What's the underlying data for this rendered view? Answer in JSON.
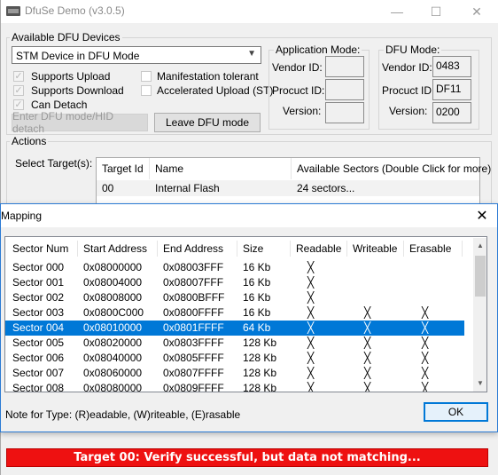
{
  "main": {
    "title": "DfuSe Demo (v3.0.5)",
    "titlebar_buttons": {
      "minimize": "—",
      "maximize": "☐",
      "close": "✕"
    },
    "devices_group": {
      "label": "Available DFU Devices",
      "selected_device": "STM Device in DFU Mode",
      "checkboxes": [
        {
          "label": "Supports Upload",
          "checked": true
        },
        {
          "label": "Supports Download",
          "checked": true
        },
        {
          "label": "Can Detach",
          "checked": true
        },
        {
          "label": "Manifestation tolerant",
          "checked": false
        },
        {
          "label": "Accelerated Upload (ST)",
          "checked": false
        }
      ],
      "enter_dfu_button": "Enter DFU mode/HID detach",
      "leave_dfu_button": "Leave DFU mode"
    },
    "app_mode": {
      "label": "Application Mode:",
      "vendor_label": "Vendor ID:",
      "product_label": "Procuct ID:",
      "version_label": "Version:",
      "vendor_value": "",
      "product_value": "",
      "version_value": ""
    },
    "dfu_mode": {
      "label": "DFU Mode:",
      "vendor_label": "Vendor ID:",
      "product_label": "Procuct ID:",
      "version_label": "Version:",
      "vendor_value": "0483",
      "product_value": "DF11",
      "version_value": "0200"
    },
    "actions": {
      "label": "Actions",
      "select_target_label": "Select Target(s):",
      "columns": [
        "Target Id",
        "Name",
        "Available Sectors (Double Click for more)"
      ],
      "rows": [
        {
          "id": "00",
          "name": "Internal Flash",
          "sectors": "24 sectors..."
        }
      ]
    },
    "status_message": "Target 00: Verify successful, but data not matching..."
  },
  "mapping": {
    "title": "Mapping",
    "close_glyph": "✕",
    "columns": [
      "Sector Num",
      "Start Address",
      "End Address",
      "Size",
      "Readable",
      "Writeable",
      "Erasable"
    ],
    "rows": [
      {
        "num": "Sector 000",
        "start": "0x08000000",
        "end": "0x08003FFF",
        "size": "16 Kb",
        "r": "╳",
        "w": "",
        "e": ""
      },
      {
        "num": "Sector 001",
        "start": "0x08004000",
        "end": "0x08007FFF",
        "size": "16 Kb",
        "r": "╳",
        "w": "",
        "e": ""
      },
      {
        "num": "Sector 002",
        "start": "0x08008000",
        "end": "0x0800BFFF",
        "size": "16 Kb",
        "r": "╳",
        "w": "",
        "e": ""
      },
      {
        "num": "Sector 003",
        "start": "0x0800C000",
        "end": "0x0800FFFF",
        "size": "16 Kb",
        "r": "╳",
        "w": "╳",
        "e": "╳"
      },
      {
        "num": "Sector 004",
        "start": "0x08010000",
        "end": "0x0801FFFF",
        "size": "64 Kb",
        "r": "╳",
        "w": "╳",
        "e": "╳",
        "selected": true
      },
      {
        "num": "Sector 005",
        "start": "0x08020000",
        "end": "0x0803FFFF",
        "size": "128 Kb",
        "r": "╳",
        "w": "╳",
        "e": "╳"
      },
      {
        "num": "Sector 006",
        "start": "0x08040000",
        "end": "0x0805FFFF",
        "size": "128 Kb",
        "r": "╳",
        "w": "╳",
        "e": "╳"
      },
      {
        "num": "Sector 007",
        "start": "0x08060000",
        "end": "0x0807FFFF",
        "size": "128 Kb",
        "r": "╳",
        "w": "╳",
        "e": "╳"
      },
      {
        "num": "Sector 008",
        "start": "0x08080000",
        "end": "0x0809FFFF",
        "size": "128 Kb",
        "r": "╳",
        "w": "╳",
        "e": "╳"
      }
    ],
    "note": "Note for Type: (R)eadable, (W)riteable, (E)rasable",
    "ok_button": "OK",
    "scroll_up_glyph": "▲",
    "scroll_down_glyph": "▼"
  }
}
